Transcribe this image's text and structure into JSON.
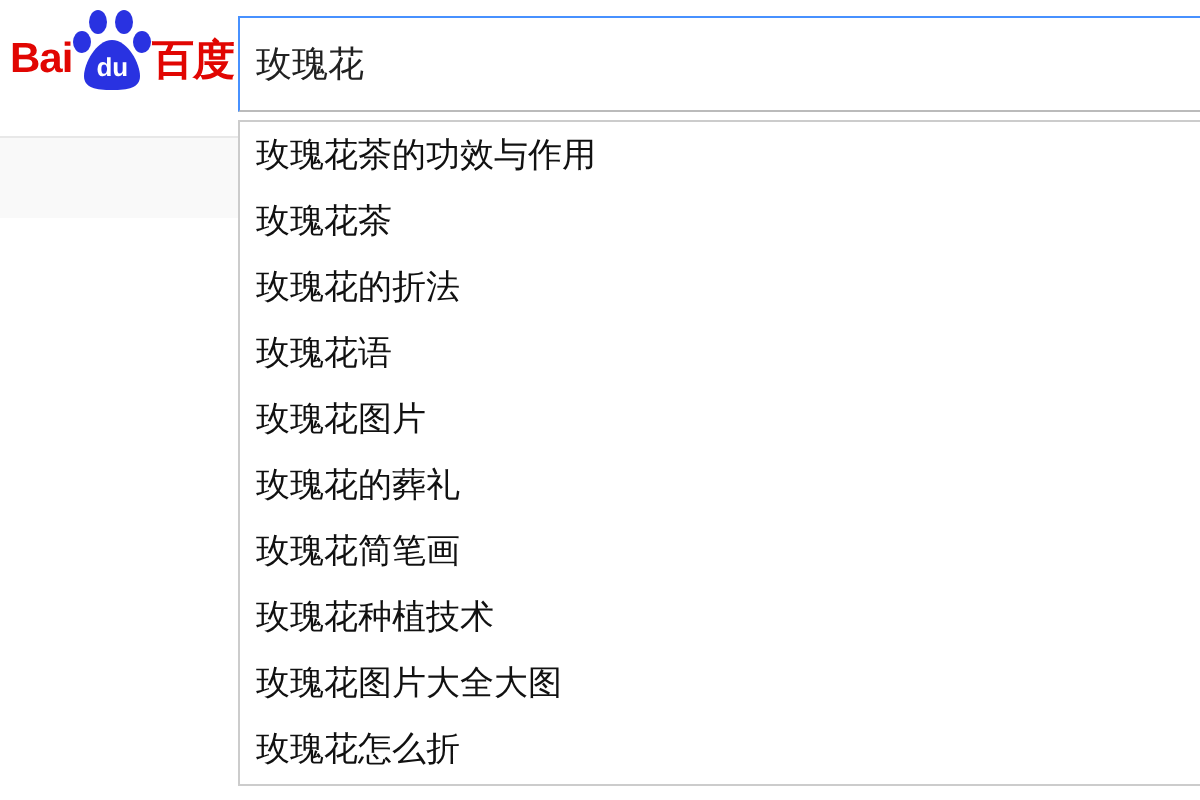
{
  "logo": {
    "left": "Bai",
    "paw": "du",
    "right": "百度"
  },
  "search": {
    "value": "玫瑰花"
  },
  "suggestions": [
    "玫瑰花茶的功效与作用",
    "玫瑰花茶",
    "玫瑰花的折法",
    "玫瑰花语",
    "玫瑰花图片",
    "玫瑰花的葬礼",
    "玫瑰花简笔画",
    "玫瑰花种植技术",
    "玫瑰花图片大全大图",
    "玫瑰花怎么折"
  ]
}
